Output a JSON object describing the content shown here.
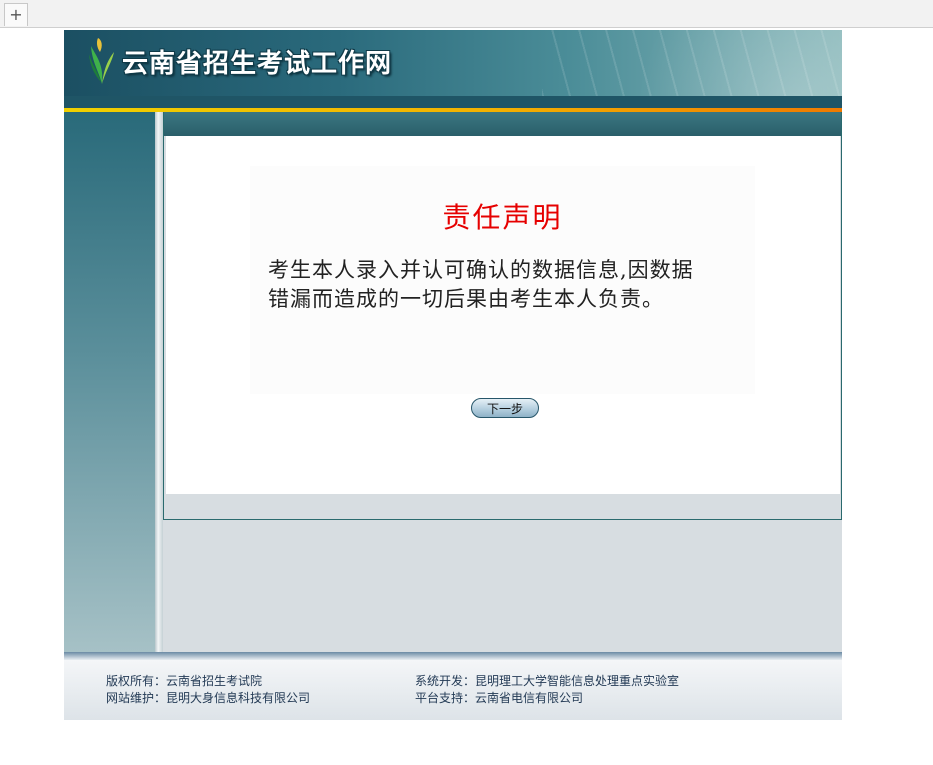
{
  "browser": {
    "new_tab_label": "+"
  },
  "header": {
    "site_title": "云南省招生考试工作网"
  },
  "notice": {
    "title": "责任声明",
    "text_line1": "考生本人录入并认可确认的数据信息,因数据",
    "text_line2": "错漏而造成的一切后果由考生本人负责。"
  },
  "actions": {
    "next_label": "下一步"
  },
  "footer": {
    "copyright": "版权所有：云南省招生考试院",
    "maintenance": "网站维护：昆明大身信息科技有限公司",
    "development": "系统开发：昆明理工大学智能信息处理重点实验室",
    "platform": "平台支持：云南省电信有限公司"
  },
  "colors": {
    "header_dark": "#1b4f62",
    "accent_yellow": "#f0d000",
    "accent_orange": "#f07a00",
    "notice_title": "#e60000",
    "footer_text": "#233a55"
  },
  "icons": {
    "logo": "yunnan-exam-logo-icon"
  }
}
